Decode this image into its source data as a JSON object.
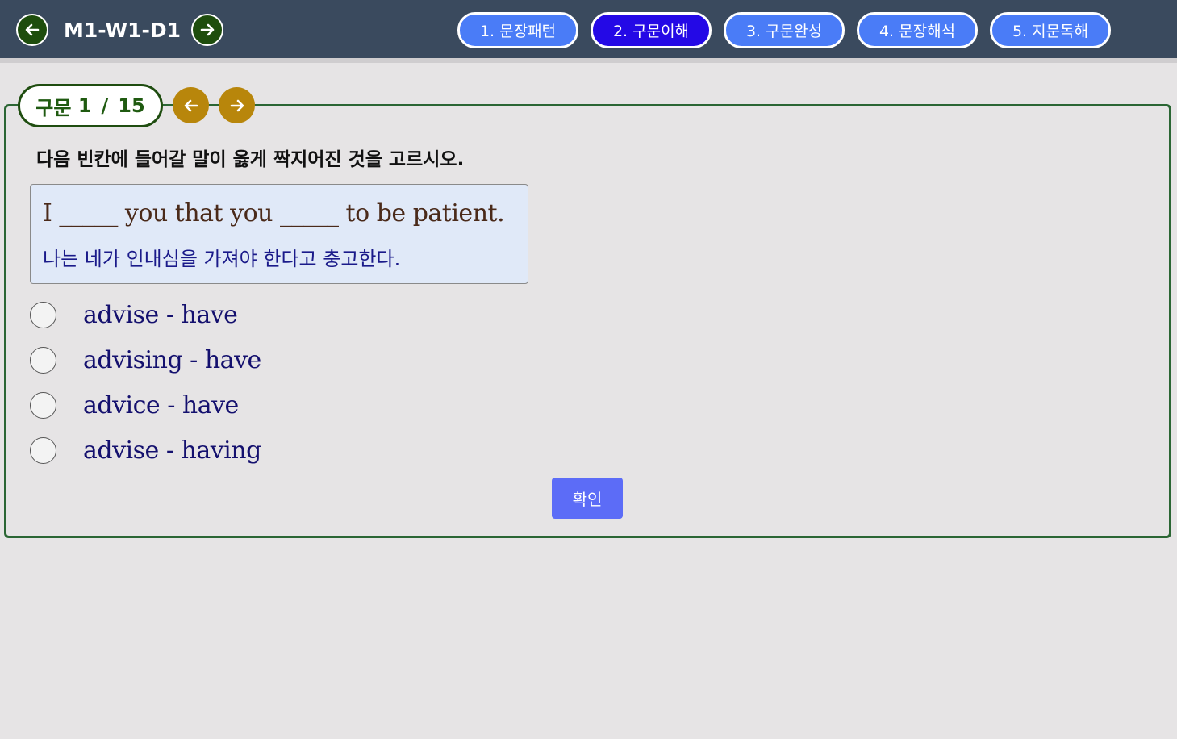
{
  "header": {
    "title": "M1-W1-D1",
    "prev_icon": "arrow-left-icon",
    "next_icon": "arrow-right-icon",
    "bg_color": "#3a4a5e",
    "nav_btn_color": "#1e4d0d"
  },
  "tabs": [
    {
      "label": "1. 문장패턴",
      "active": false
    },
    {
      "label": "2. 구문이해",
      "active": true
    },
    {
      "label": "3. 구문완성",
      "active": false
    },
    {
      "label": "4. 문장해석",
      "active": false
    },
    {
      "label": "5. 지문독해",
      "active": false
    }
  ],
  "tab_colors": {
    "default": "#4a7cf7",
    "active": "#2409e6"
  },
  "question": {
    "counter_label": "구문",
    "current": "1",
    "separator": "/",
    "total": "15",
    "instruction": "다음 빈칸에 들어갈 말이 옳게 짝지어진 것을 고르시오.",
    "sentence_en": "I _____ you that you _____ to be patient.",
    "sentence_ko": "나는 네가 인내심을 가져야 한다고 충고한다.",
    "options": [
      {
        "label": "advise - have",
        "selected": false
      },
      {
        "label": "advising - have",
        "selected": false
      },
      {
        "label": "advice - have",
        "selected": false
      },
      {
        "label": "advise - having",
        "selected": false
      }
    ],
    "confirm_label": "확인"
  },
  "colors": {
    "panel_border": "#2b6634",
    "gold_nav": "#b8860b",
    "confirm_bg": "#5c6cf7"
  }
}
